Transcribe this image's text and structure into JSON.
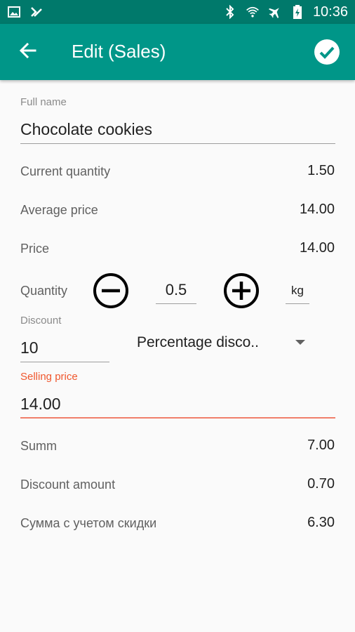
{
  "status_bar": {
    "time": "10:36",
    "left_icons": [
      "image-icon",
      "checkmark-notification-icon"
    ],
    "right_icons": [
      "bluetooth-icon",
      "wifi-icon",
      "airplane-icon",
      "battery-charging-icon"
    ]
  },
  "toolbar": {
    "title": "Edit (Sales)",
    "back_icon": "arrow-left-icon",
    "confirm_icon": "check-circle-icon",
    "color": "#009688"
  },
  "form": {
    "full_name_label": "Full name",
    "full_name_value": "Chocolate cookies",
    "current_quantity_label": "Current quantity",
    "current_quantity_value": "1.50",
    "average_price_label": "Average price",
    "average_price_value": "14.00",
    "price_label": "Price",
    "price_value": "14.00",
    "quantity_label": "Quantity",
    "quantity_value": "0.5",
    "unit_value": "kg",
    "discount_label": "Discount",
    "discount_value": "10",
    "discount_type_selected": "Percentage disco..",
    "selling_price_label": "Selling price",
    "selling_price_value": "14.00",
    "error_color": "#f0572e"
  },
  "summary": {
    "summ_label": "Summ",
    "summ_value": "7.00",
    "discount_amount_label": "Discount amount",
    "discount_amount_value": "0.70",
    "total_label": "Сумма с учетом скидки",
    "total_value": "6.30"
  }
}
